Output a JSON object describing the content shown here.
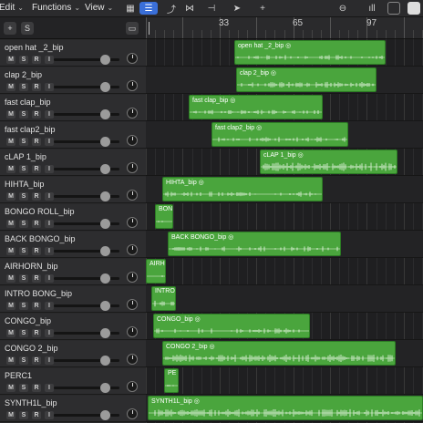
{
  "menubar": {
    "edit": "Edit",
    "functions": "Functions",
    "view": "View"
  },
  "ruler": {
    "bars": [
      "33",
      "65",
      "97"
    ]
  },
  "tracks": [
    {
      "name": "open hat _2_bip",
      "region": "open hat _2_bip",
      "icon": true
    },
    {
      "name": "clap 2_bip",
      "region": "clap 2_bip",
      "icon": true
    },
    {
      "name": "fast clap_bip",
      "region": "fast clap_bip",
      "icon": true
    },
    {
      "name": "fast clap2_bip",
      "region": "fast clap2_bip",
      "icon": true
    },
    {
      "name": "cLAP 1_bip",
      "region": "cLAP 1_bip",
      "icon": true
    },
    {
      "name": "HIHTA_bip",
      "region": "HIHTA_bip",
      "icon": true
    },
    {
      "name": "BONGO ROLL_bip",
      "region": "BON",
      "icon": false
    },
    {
      "name": "BACK BONGO_bip",
      "region": "BACK BONGO_bip",
      "icon": true
    },
    {
      "name": "AIRHORN_bip",
      "region": "AIRH",
      "icon": false
    },
    {
      "name": "INTRO BONG_bip",
      "region": "INTRO",
      "icon": false
    },
    {
      "name": "CONGO_bip",
      "region": "CONGO_bip",
      "icon": true
    },
    {
      "name": "CONGO 2_bip",
      "region": "CONGO 2_bip",
      "icon": true
    },
    {
      "name": "PERC1",
      "region": "PE",
      "icon": false
    },
    {
      "name": "SYNTH1L_bip",
      "region": "SYNTH1L_bip",
      "icon": true
    }
  ],
  "track_buttons": {
    "m": "M",
    "s": "S",
    "r": "R",
    "i": "I"
  },
  "header": {
    "s_label": "S"
  },
  "colors": {
    "region": "#4aa53d",
    "region_border": "#2c7d24",
    "accent": "#3a6fd8"
  }
}
